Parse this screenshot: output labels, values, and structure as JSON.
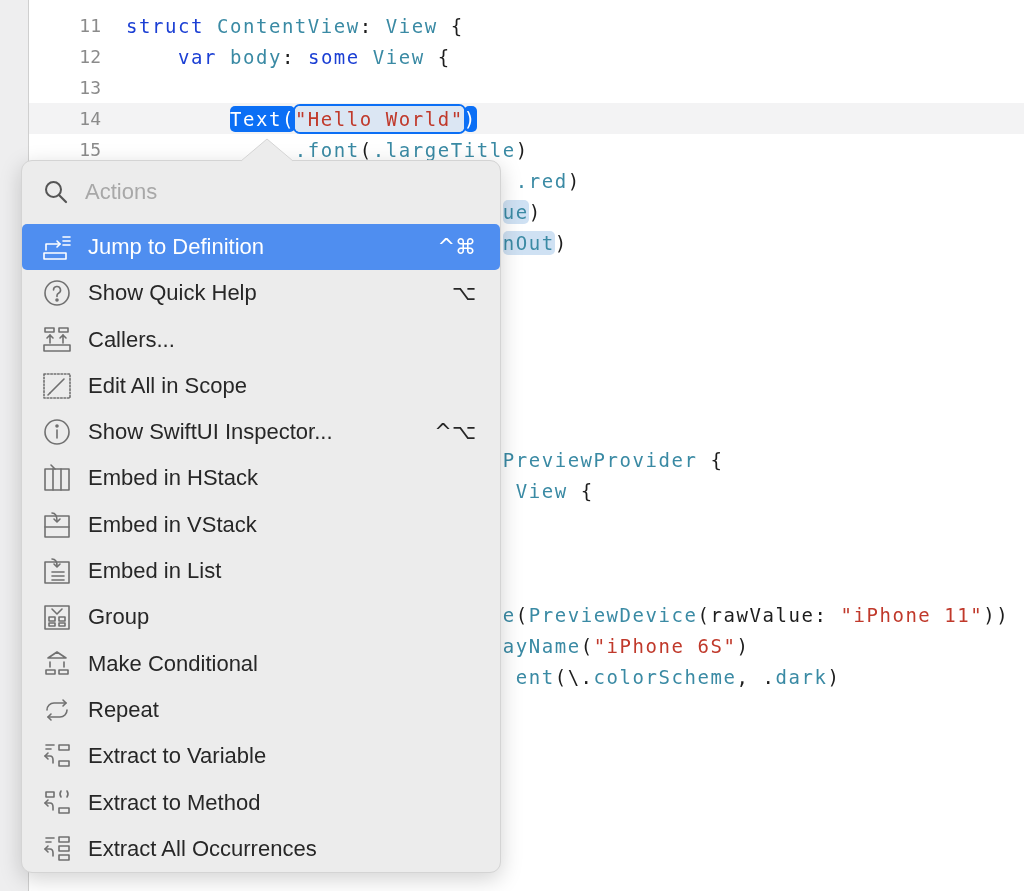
{
  "editor": {
    "lines": [
      {
        "number": "11",
        "current": false,
        "tokens": [
          {
            "text": "struct ",
            "kind": "keyword"
          },
          {
            "text": "ContentView",
            "kind": "type"
          },
          {
            "text": ": ",
            "kind": "plain"
          },
          {
            "text": "View",
            "kind": "type"
          },
          {
            "text": " {",
            "kind": "plain"
          }
        ]
      },
      {
        "number": "12",
        "current": false,
        "tokens": [
          {
            "text": "    var ",
            "kind": "keyword"
          },
          {
            "text": "body",
            "kind": "type"
          },
          {
            "text": ": ",
            "kind": "plain"
          },
          {
            "text": "some ",
            "kind": "keyword"
          },
          {
            "text": "View",
            "kind": "type"
          },
          {
            "text": " {",
            "kind": "plain"
          }
        ]
      },
      {
        "number": "13",
        "current": false
      },
      {
        "number": "14",
        "current": true,
        "tokens": [
          {
            "text": "        Text(",
            "kind": "selected"
          },
          {
            "text": "\"Hello World\"",
            "kind": "selected-string"
          },
          {
            "text": ")",
            "kind": "selected"
          }
        ]
      },
      {
        "number": "15",
        "current": false,
        "tokens": [
          {
            "text": "             .font",
            "kind": "type"
          },
          {
            "text": "(",
            "kind": "plain"
          },
          {
            "text": ".largeTitle",
            "kind": "type"
          },
          {
            "text": ")",
            "kind": "plain"
          }
        ]
      },
      {
        "current": false,
        "tokens": [
          {
            "text": "                              .red",
            "kind": "type"
          },
          {
            "text": ")",
            "kind": "plain"
          }
        ]
      },
      {
        "current": false,
        "tokens": [
          {
            "text": "                             ue",
            "kind": "token-highlight"
          },
          {
            "text": ")",
            "kind": "plain"
          }
        ]
      },
      {
        "current": false,
        "tokens": [
          {
            "text": "                             nOut",
            "kind": "token-highlight"
          },
          {
            "text": ")",
            "kind": "plain"
          }
        ]
      },
      {
        "current": false
      },
      {
        "current": false
      },
      {
        "current": false
      },
      {
        "current": false
      },
      {
        "current": false
      },
      {
        "current": false
      },
      {
        "current": false,
        "tokens": [
          {
            "text": "                             PreviewProvider",
            "kind": "type"
          },
          {
            "text": " {",
            "kind": "plain"
          }
        ]
      },
      {
        "current": false,
        "tokens": [
          {
            "text": "                              View",
            "kind": "type"
          },
          {
            "text": " {",
            "kind": "plain"
          }
        ]
      },
      {
        "current": false
      },
      {
        "current": false
      },
      {
        "current": false
      },
      {
        "current": false,
        "tokens": [
          {
            "text": "                             e",
            "kind": "type"
          },
          {
            "text": "(",
            "kind": "plain"
          },
          {
            "text": "PreviewDevice",
            "kind": "type"
          },
          {
            "text": "(rawValue: ",
            "kind": "plain"
          },
          {
            "text": "\"iPhone 11\"",
            "kind": "string"
          },
          {
            "text": "))",
            "kind": "plain"
          }
        ]
      },
      {
        "current": false,
        "tokens": [
          {
            "text": "                             ayName",
            "kind": "type"
          },
          {
            "text": "(",
            "kind": "plain"
          },
          {
            "text": "\"iPhone 6S\"",
            "kind": "string"
          },
          {
            "text": ")",
            "kind": "plain"
          }
        ]
      },
      {
        "current": false,
        "tokens": [
          {
            "text": "                              ent",
            "kind": "type"
          },
          {
            "text": "(\\.",
            "kind": "plain"
          },
          {
            "text": "colorScheme",
            "kind": "type"
          },
          {
            "text": ", .",
            "kind": "plain"
          },
          {
            "text": "dark",
            "kind": "type"
          },
          {
            "text": ")",
            "kind": "plain"
          }
        ]
      }
    ]
  },
  "actions_menu": {
    "search": {
      "placeholder": "Actions"
    },
    "items": [
      {
        "label": "Jump to Definition",
        "shortcut": "^⌘",
        "selected": true
      },
      {
        "label": "Show Quick Help",
        "shortcut": "⌥",
        "selected": false
      },
      {
        "label": "Callers...",
        "selected": false
      },
      {
        "label": "Edit All in Scope",
        "selected": false
      },
      {
        "label": "Show SwiftUI Inspector...",
        "shortcut": "^⌥",
        "selected": false
      },
      {
        "label": "Embed in HStack",
        "selected": false
      },
      {
        "label": "Embed in VStack",
        "selected": false
      },
      {
        "label": "Embed in List",
        "selected": false
      },
      {
        "label": "Group",
        "selected": false
      },
      {
        "label": "Make Conditional",
        "selected": false
      },
      {
        "label": "Repeat",
        "selected": false
      },
      {
        "label": "Extract to Variable",
        "selected": false
      },
      {
        "label": "Extract to Method",
        "selected": false
      },
      {
        "label": "Extract All Occurrences",
        "selected": false
      }
    ]
  }
}
